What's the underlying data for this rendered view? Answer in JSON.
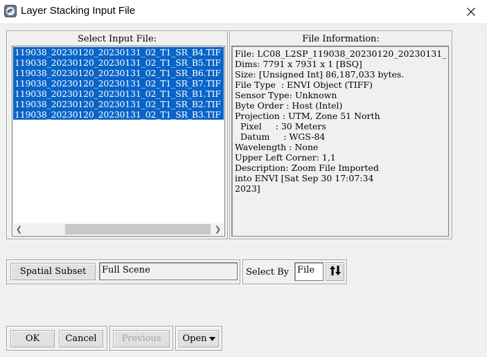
{
  "window": {
    "title": "Layer Stacking Input File"
  },
  "select_panel": {
    "label": "Select Input File:",
    "files": [
      "119038_20230120_20230131_02_T1_SR_B4.TIF",
      "119038_20230120_20230131_02_T1_SR_B5.TIF",
      "119038_20230120_20230131_02_T1_SR_B6.TIF",
      "119038_20230120_20230131_02_T1_SR_B7.TIF",
      "119038_20230120_20230131_02_T1_SR_B1.TIF",
      "119038_20230120_20230131_02_T1_SR_B2.TIF",
      "119038_20230120_20230131_02_T1_SR_B3.TIF"
    ]
  },
  "info_panel": {
    "label": "File Information:",
    "lines": [
      "File: LC08_L2SP_119038_20230120_20230131_",
      "Dims: 7791 x 7931 x 1 [BSQ]",
      "Size: [Unsigned Int] 86,187,033 bytes.",
      "File Type  : ENVI Object (TIFF)",
      "Sensor Type: Unknown",
      "Byte Order : Host (Intel)",
      "Projection : UTM, Zone 51 North",
      "  Pixel     : 30 Meters",
      "  Datum     : WGS-84",
      "Wavelength : None",
      "Upper Left Corner: 1,1",
      "Description: Zoom File Imported",
      "into ENVI [Sat Sep 30 17:07:34",
      "2023]"
    ]
  },
  "subset": {
    "button_label": "Spatial Subset",
    "value": "Full Scene"
  },
  "select_by": {
    "label": "Select By",
    "value": "File"
  },
  "buttons": {
    "ok": "OK",
    "cancel": "Cancel",
    "previous": "Previous",
    "open": "Open"
  },
  "colors": {
    "selection": "#0a64c8",
    "background": "#f0f0f0"
  }
}
